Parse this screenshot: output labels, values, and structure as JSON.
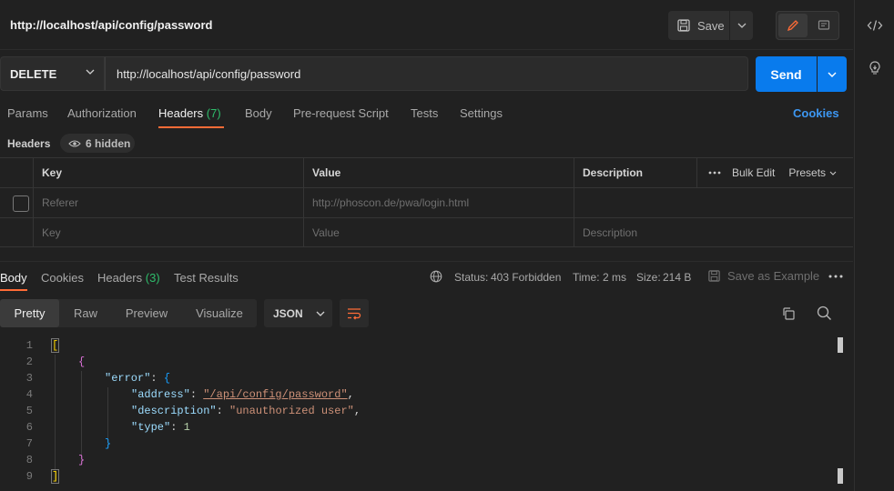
{
  "request": {
    "title": "http://localhost/api/config/password",
    "save_label": "Save",
    "method": "DELETE",
    "url": "http://localhost/api/config/password",
    "send_label": "Send"
  },
  "request_tabs": [
    {
      "label": "Params"
    },
    {
      "label": "Authorization"
    },
    {
      "label": "Headers",
      "count": "(7)"
    },
    {
      "label": "Body"
    },
    {
      "label": "Pre-request Script"
    },
    {
      "label": "Tests"
    },
    {
      "label": "Settings"
    }
  ],
  "cookies_label": "Cookies",
  "headers_section": {
    "label": "Headers",
    "hidden_label": "6 hidden",
    "columns": [
      "Key",
      "Value",
      "Description"
    ],
    "bulk_edit": "Bulk Edit",
    "presets": "Presets",
    "rows": [
      {
        "key": "Referer",
        "value": "http://phoscon.de/pwa/login.html",
        "description": ""
      }
    ],
    "placeholder": {
      "key": "Key",
      "value": "Value",
      "description": "Description"
    }
  },
  "response": {
    "tabs": [
      {
        "label": "Body"
      },
      {
        "label": "Cookies"
      },
      {
        "label": "Headers",
        "count": "(3)"
      },
      {
        "label": "Test Results"
      }
    ],
    "status_label": "Status:",
    "status_value": "403 Forbidden",
    "time_label": "Time:",
    "time_value": "2 ms",
    "size_label": "Size:",
    "size_value": "214 B",
    "save_example": "Save as Example",
    "view_modes": [
      "Pretty",
      "Raw",
      "Preview",
      "Visualize"
    ],
    "format": "JSON"
  },
  "code_lines": {
    "numbers": [
      "1",
      "2",
      "3",
      "4",
      "5",
      "6",
      "7",
      "8",
      "9"
    ],
    "open_bracket": "[",
    "open_brace": "{",
    "error_key": "\"error\"",
    "address_key": "\"address\"",
    "address_value": "\"/api/config/password\"",
    "description_key": "\"description\"",
    "description_value": "\"unauthorized user\"",
    "type_key": "\"type\"",
    "type_value": "1",
    "close_inner": "}",
    "close_outer": "}",
    "close_bracket": "]"
  },
  "colors": {
    "accent": "#ff6c37",
    "send": "#097bed",
    "status_ok": "#2ebd6b",
    "link": "#3d97f2"
  }
}
